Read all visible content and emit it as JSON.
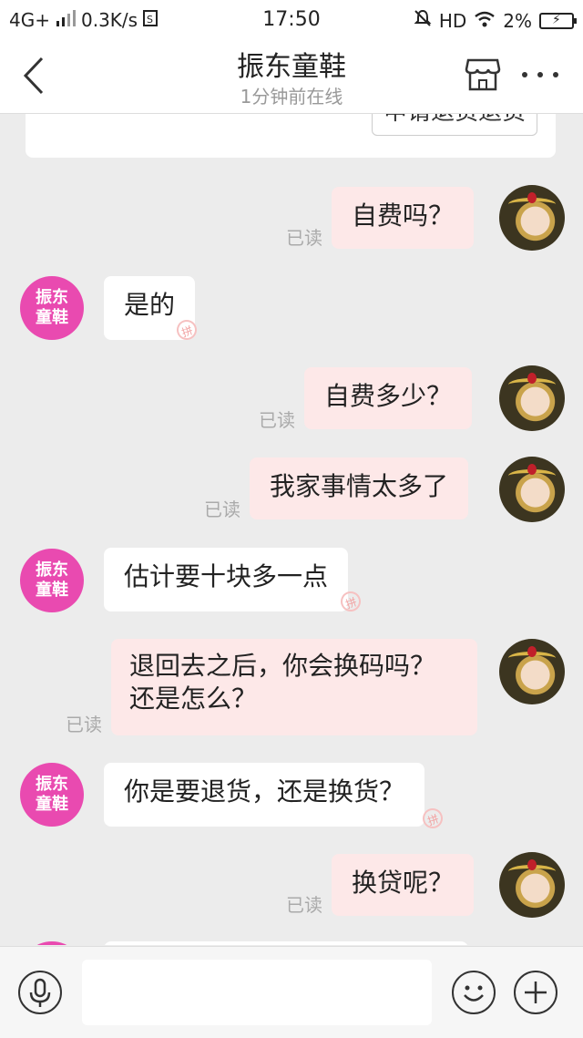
{
  "status_bar": {
    "network": "4G+",
    "speed": "0.3K/s",
    "time": "17:50",
    "hd": "HD",
    "battery": "2%"
  },
  "header": {
    "title": "振东童鞋",
    "subtitle": "1分钟前在线",
    "icons": [
      "back-chevron-icon",
      "shop-icon",
      "more-dots-icon"
    ]
  },
  "chat": {
    "card_button": "申请退货退货",
    "shop_avatar_text": "振东\n童鞋",
    "messages": [
      {
        "side": "out",
        "text": "自费吗？",
        "status": "已读"
      },
      {
        "side": "in",
        "text": "是的"
      },
      {
        "side": "out",
        "text": "自费多少？",
        "status": "已读"
      },
      {
        "side": "out",
        "text": "我家事情太多了",
        "status": "已读"
      },
      {
        "side": "in",
        "text": "估计要十块多一点"
      },
      {
        "side": "out",
        "text": "退回去之后，你会换码吗？还是怎么？",
        "status": "已读"
      },
      {
        "side": "in",
        "text": "你是要退货，还是换货？"
      },
      {
        "side": "out",
        "text": "换贷呢？",
        "status": "已读"
      }
    ]
  },
  "input_bar": {
    "placeholder": "",
    "icons": [
      "microphone-icon",
      "emoji-icon",
      "plus-icon"
    ]
  },
  "colors": {
    "shop_avatar": "#e94ab0",
    "out_bubble": "#fde8e8",
    "in_bubble": "#ffffff",
    "background": "#ececec"
  }
}
